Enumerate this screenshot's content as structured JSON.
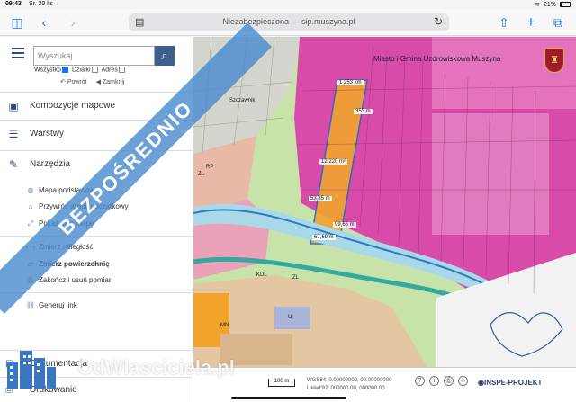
{
  "status": {
    "time": "09:43",
    "date": "Śr. 20 lis",
    "battery_text": "21%",
    "battery_level": 0.21
  },
  "browser": {
    "url_text": "Niezabezpieczona — sip.muszyna.pl",
    "icons": {
      "sidebar": "sidebar-icon",
      "back": "chevron-left-icon",
      "forward": "chevron-right-icon",
      "reader": "reader-icon",
      "reload": "reload-icon",
      "share": "share-icon",
      "new_tab": "plus-icon",
      "tabs": "tabs-icon"
    }
  },
  "sidebar": {
    "search_placeholder": "Wyszukaj",
    "filters": [
      {
        "label": "Wszystko",
        "checked": true
      },
      {
        "label": "Działki",
        "checked": false
      },
      {
        "label": "Adres",
        "checked": false
      }
    ],
    "back_label": "Powrót",
    "close_label": "Zamknij",
    "sections": {
      "compositions": "Kompozycje mapowe",
      "layers": "Warstwy",
      "tools": "Narzędzia",
      "documentation": "Dokumentacja",
      "print": "Drukowanie"
    },
    "tools": [
      {
        "label": "Mapa podstawowa",
        "bold": false
      },
      {
        "label": "Przywróć widok początkowy",
        "bold": false
      },
      {
        "label": "Pokaż całą mapę",
        "bold": false
      },
      {
        "label": "Zmierz odległość",
        "bold": false
      },
      {
        "label": "Zmierz powierzchnię",
        "bold": true
      },
      {
        "label": "Zakończ i usuń pomiar",
        "bold": false
      },
      {
        "label": "Generuj link",
        "bold": false
      }
    ]
  },
  "map": {
    "title": "Miasto i Gmina Uzdrowiskowa Muszyna",
    "measurements": [
      "1 253 km",
      "353 m",
      "12 220 m²",
      "53,85 m",
      "99,66 m",
      "67,69 m"
    ],
    "labels": [
      "Szczawnik",
      "ZL",
      "RP",
      "MN",
      "KDL",
      "ZL",
      "U"
    ],
    "brand": "INSPE-PROJEKT",
    "crest_icon": "coat-of-arms-icon"
  },
  "footer": {
    "scale": "100 m",
    "wgs84": "WGS84: 0.00000000, 00.00000000",
    "uklad92": "Układ'92: 000000.00, 000000.00",
    "brand": "INSPE-PROJEKT"
  },
  "overlay": {
    "ribbon_text": "BEZPOŚREDNIO",
    "watermark": "OdWlasciciela.pl"
  },
  "colors": {
    "accent": "#0a7aff",
    "panel_blue": "#3d5f8f",
    "ribbon": "#4b8ccd",
    "forest": "#d5339b",
    "highlight": "#f0a330"
  }
}
